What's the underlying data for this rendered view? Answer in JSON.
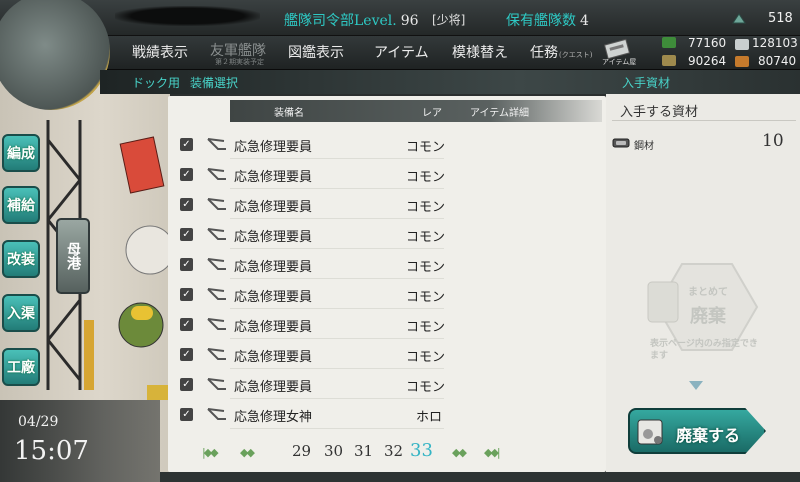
{
  "topbar": {
    "hq_label": "艦隊司令部Level.",
    "hq_level": "96",
    "rank": "[少将]",
    "fleet_label": "保有艦隊数",
    "fleet_count": "4",
    "coins": "518"
  },
  "menu": {
    "items": [
      {
        "label": "戦績表示"
      },
      {
        "label": "友軍艦隊",
        "sub": "第２期実装予定"
      },
      {
        "label": "図鑑表示"
      },
      {
        "label": "アイテム"
      },
      {
        "label": "模様替え"
      },
      {
        "label": "任務",
        "small": "(クエスト)"
      }
    ],
    "item_shop": "アイテム屋"
  },
  "resources": {
    "fuel": "77160",
    "ammo": "90264",
    "steel": "128103",
    "bauxite": "80740"
  },
  "sidebar": {
    "buttons": [
      "編成",
      "補給",
      "改装",
      "入渠",
      "工廠"
    ],
    "bosshi": "母港"
  },
  "clock": {
    "date": "04/29",
    "time": "15:07"
  },
  "breadcrumb": {
    "left": "ドック用",
    "title": "装備選択",
    "right": "入手資材"
  },
  "list": {
    "headers": {
      "name": "装備名",
      "rarity": "レア",
      "detail": "アイテム詳細"
    },
    "rows": [
      {
        "name": "応急修理要員",
        "rarity": "コモン"
      },
      {
        "name": "応急修理要員",
        "rarity": "コモン"
      },
      {
        "name": "応急修理要員",
        "rarity": "コモン"
      },
      {
        "name": "応急修理要員",
        "rarity": "コモン"
      },
      {
        "name": "応急修理要員",
        "rarity": "コモン"
      },
      {
        "name": "応急修理要員",
        "rarity": "コモン"
      },
      {
        "name": "応急修理要員",
        "rarity": "コモン"
      },
      {
        "name": "応急修理要員",
        "rarity": "コモン"
      },
      {
        "name": "応急修理要員",
        "rarity": "コモン"
      },
      {
        "name": "応急修理女神",
        "rarity": "ホロ"
      }
    ],
    "check_mark": "✓"
  },
  "pager": {
    "pages": [
      "29",
      "30",
      "31",
      "32",
      "33"
    ],
    "current": "33"
  },
  "right_panel": {
    "title": "入手する資材",
    "steel_label": "鋼材",
    "steel_value": "10",
    "bulk_a": "まとめて",
    "bulk_b": "廃棄",
    "bulk_sub": "表示ページ内のみ指定できます",
    "discard_button": "廃棄する"
  },
  "colors": {
    "accent": "#2ec9c4",
    "button": "#2a8f88",
    "page_current": "#34b4c4"
  }
}
